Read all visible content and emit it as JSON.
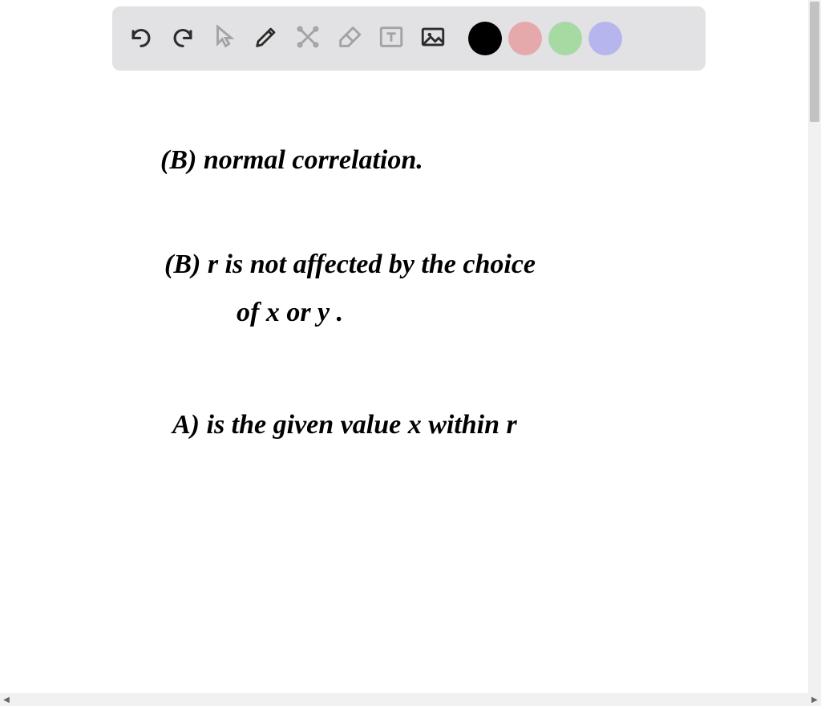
{
  "toolbar": {
    "items": [
      {
        "name": "undo-icon",
        "interactable": true
      },
      {
        "name": "redo-icon",
        "interactable": true
      },
      {
        "name": "pointer-icon",
        "interactable": false
      },
      {
        "name": "pen-icon",
        "interactable": true
      },
      {
        "name": "tools-icon",
        "interactable": false
      },
      {
        "name": "eraser-icon",
        "interactable": false
      },
      {
        "name": "textbox-icon",
        "interactable": false
      },
      {
        "name": "image-icon",
        "interactable": true
      }
    ],
    "swatches": [
      {
        "name": "color-black",
        "hex": "#000000"
      },
      {
        "name": "color-pink",
        "hex": "#e6a9ab"
      },
      {
        "name": "color-green",
        "hex": "#a7d9a3"
      },
      {
        "name": "color-purple",
        "hex": "#b6b5ed"
      }
    ]
  },
  "notes": {
    "line1": "(B)  normal  correlation.",
    "line2a": "(B)  r  is  not  affected  by  the  choice",
    "line2b": "of  x  or  y .",
    "line3": "A)  is  the  given  value  x  within  r"
  }
}
